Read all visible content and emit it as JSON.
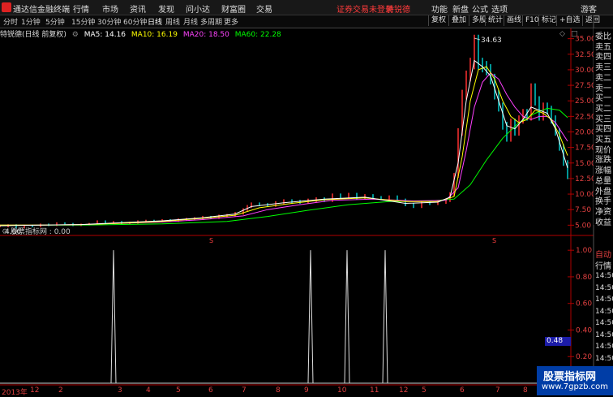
{
  "app": {
    "name": "通达信金融终端",
    "menu": [
      "行情",
      "市场",
      "资讯",
      "发现",
      "问小达",
      "财富圈",
      "交易"
    ],
    "notice": "证券交易未登录",
    "notice_stock": "特锐德",
    "right_menu": [
      "功能",
      "新盘",
      "公式",
      "选项",
      "游客"
    ]
  },
  "toolbar": {
    "periods": [
      "分时",
      "1分钟",
      "5分钟",
      "15分钟",
      "30分钟",
      "60分钟",
      "日线",
      "周线",
      "月线",
      "多周期",
      "更多"
    ],
    "active_period": "日线",
    "buttons": [
      "复权",
      "叠加",
      "多股",
      "统计",
      "画线",
      "F10",
      "标记",
      "+自选",
      "返回"
    ]
  },
  "legend": {
    "title": "特锐德(日线 前复权)",
    "ma5": "MA5: 14.16",
    "ma10": "MA10: 16.19",
    "ma20": "MA20: 18.50",
    "ma60": "MA60: 22.28"
  },
  "colors": {
    "ma5": "#ffffff",
    "ma10": "#ffff00",
    "ma20": "#ff40ff",
    "ma60": "#00ff00",
    "axis": "#e04040",
    "up": "#ff3030",
    "down": "#00c8c8"
  },
  "price_axis": [
    "35.00",
    "32.50",
    "30.00",
    "27.50",
    "25.00",
    "22.50",
    "20.00",
    "17.50",
    "15.00",
    "12.50",
    "10.00",
    "7.50",
    "5.00"
  ],
  "price_labels": {
    "high": "34.63",
    "low": "4.06"
  },
  "side_panel": [
    "委比",
    "卖五",
    "卖四",
    "卖三",
    "卖二",
    "卖一",
    "买一",
    "买二",
    "买三",
    "买四",
    "买五",
    "现价",
    "涨跌",
    "涨幅",
    "总量",
    "外盘",
    "换手",
    "净资",
    "收益"
  ],
  "auto_panel": {
    "label1": "自动",
    "label2": "行情",
    "times": [
      "14:50",
      "14:50",
      "14:50",
      "14:50",
      "14:50",
      "14:50",
      "14:50",
      "14:50",
      "14:50"
    ]
  },
  "indicator": {
    "title": "股票指标网 : 0.00",
    "axis": [
      "1.00",
      "0.80",
      "0.60",
      "0.40",
      "0.20"
    ],
    "highlight": "0.48"
  },
  "x_axis": [
    "2013年",
    "12",
    "2",
    "3",
    "4",
    "5",
    "6",
    "7",
    "8",
    "9",
    "10",
    "11",
    "12",
    "5",
    "6",
    "7",
    "8"
  ],
  "watermark": {
    "line1": "股票指标网",
    "line2": "www.7gpzb.com"
  },
  "chart_data": {
    "type": "line",
    "price_series": [
      [
        0,
        4.8
      ],
      [
        10,
        5.0
      ],
      [
        20,
        4.6
      ],
      [
        30,
        4.9
      ],
      [
        40,
        4.8
      ],
      [
        50,
        5.1
      ],
      [
        60,
        5.0
      ],
      [
        70,
        5.3
      ],
      [
        80,
        5.2
      ],
      [
        90,
        5.0
      ],
      [
        100,
        5.1
      ],
      [
        110,
        5.2
      ],
      [
        120,
        5.6
      ],
      [
        130,
        5.4
      ],
      [
        140,
        5.5
      ],
      [
        150,
        5.3
      ],
      [
        160,
        5.4
      ],
      [
        170,
        5.6
      ],
      [
        180,
        5.7
      ],
      [
        190,
        5.6
      ],
      [
        200,
        5.8
      ],
      [
        210,
        5.7
      ],
      [
        220,
        5.9
      ],
      [
        230,
        6.0
      ],
      [
        240,
        6.1
      ],
      [
        250,
        6.3
      ],
      [
        260,
        6.2
      ],
      [
        270,
        6.5
      ],
      [
        280,
        6.6
      ],
      [
        290,
        6.9
      ],
      [
        300,
        7.5
      ],
      [
        305,
        8.0
      ],
      [
        310,
        8.4
      ],
      [
        320,
        8.3
      ],
      [
        330,
        8.2
      ],
      [
        340,
        8.6
      ],
      [
        350,
        8.9
      ],
      [
        360,
        8.8
      ],
      [
        370,
        8.7
      ],
      [
        380,
        9.0
      ],
      [
        390,
        9.2
      ],
      [
        400,
        9.0
      ],
      [
        410,
        9.8
      ],
      [
        420,
        9.6
      ],
      [
        430,
        9.9
      ],
      [
        440,
        9.4
      ],
      [
        450,
        9.7
      ],
      [
        460,
        9.4
      ],
      [
        470,
        9.3
      ],
      [
        480,
        9.5
      ],
      [
        490,
        9.0
      ],
      [
        500,
        8.3
      ],
      [
        510,
        8.0
      ],
      [
        520,
        8.6
      ],
      [
        530,
        8.5
      ],
      [
        540,
        8.7
      ],
      [
        550,
        9.0
      ],
      [
        555,
        10.0
      ],
      [
        560,
        13.0
      ],
      [
        565,
        20.0
      ],
      [
        570,
        26.0
      ],
      [
        575,
        29.0
      ],
      [
        580,
        31.0
      ],
      [
        585,
        34.6
      ],
      [
        590,
        31.0
      ],
      [
        595,
        30.5
      ],
      [
        600,
        30.0
      ],
      [
        605,
        28.5
      ],
      [
        610,
        26.0
      ],
      [
        615,
        24.0
      ],
      [
        620,
        21.0
      ],
      [
        625,
        19.0
      ],
      [
        630,
        21.5
      ],
      [
        635,
        20.0
      ],
      [
        640,
        22.0
      ],
      [
        645,
        23.0
      ],
      [
        650,
        22.5
      ],
      [
        655,
        27.0
      ],
      [
        660,
        25.0
      ],
      [
        665,
        22.5
      ],
      [
        670,
        24.0
      ],
      [
        675,
        23.5
      ],
      [
        680,
        22.0
      ],
      [
        685,
        20.0
      ],
      [
        690,
        17.5
      ],
      [
        695,
        15.0
      ],
      [
        700,
        12.8
      ]
    ],
    "ma5": [
      [
        0,
        4.9
      ],
      [
        50,
        5.0
      ],
      [
        100,
        5.1
      ],
      [
        150,
        5.4
      ],
      [
        200,
        5.7
      ],
      [
        250,
        6.2
      ],
      [
        290,
        6.8
      ],
      [
        310,
        8.0
      ],
      [
        350,
        8.6
      ],
      [
        400,
        9.2
      ],
      [
        450,
        9.5
      ],
      [
        500,
        8.5
      ],
      [
        540,
        8.7
      ],
      [
        555,
        9.5
      ],
      [
        565,
        15.0
      ],
      [
        575,
        25.0
      ],
      [
        585,
        31.5
      ],
      [
        595,
        30.5
      ],
      [
        605,
        29.0
      ],
      [
        615,
        25.0
      ],
      [
        625,
        21.0
      ],
      [
        635,
        20.5
      ],
      [
        645,
        22.0
      ],
      [
        655,
        24.0
      ],
      [
        665,
        23.5
      ],
      [
        675,
        23.0
      ],
      [
        685,
        20.5
      ],
      [
        700,
        14.2
      ]
    ],
    "ma10": [
      [
        0,
        5.0
      ],
      [
        50,
        5.0
      ],
      [
        100,
        5.1
      ],
      [
        150,
        5.3
      ],
      [
        200,
        5.6
      ],
      [
        250,
        6.1
      ],
      [
        290,
        6.6
      ],
      [
        320,
        7.8
      ],
      [
        360,
        8.5
      ],
      [
        400,
        9.1
      ],
      [
        450,
        9.4
      ],
      [
        500,
        8.8
      ],
      [
        540,
        8.8
      ],
      [
        560,
        9.6
      ],
      [
        570,
        16.0
      ],
      [
        580,
        25.0
      ],
      [
        590,
        30.0
      ],
      [
        600,
        30.5
      ],
      [
        610,
        28.5
      ],
      [
        620,
        25.0
      ],
      [
        630,
        22.5
      ],
      [
        640,
        21.5
      ],
      [
        650,
        22.0
      ],
      [
        660,
        23.5
      ],
      [
        670,
        23.0
      ],
      [
        680,
        22.0
      ],
      [
        690,
        19.5
      ],
      [
        700,
        16.2
      ]
    ],
    "ma20": [
      [
        0,
        5.0
      ],
      [
        50,
        5.0
      ],
      [
        100,
        5.1
      ],
      [
        150,
        5.3
      ],
      [
        200,
        5.5
      ],
      [
        250,
        5.9
      ],
      [
        300,
        6.5
      ],
      [
        330,
        7.5
      ],
      [
        370,
        8.3
      ],
      [
        410,
        9.0
      ],
      [
        460,
        9.2
      ],
      [
        510,
        8.9
      ],
      [
        550,
        9.0
      ],
      [
        565,
        11.0
      ],
      [
        575,
        17.0
      ],
      [
        585,
        24.0
      ],
      [
        595,
        28.0
      ],
      [
        605,
        29.5
      ],
      [
        615,
        28.5
      ],
      [
        625,
        26.0
      ],
      [
        635,
        24.0
      ],
      [
        645,
        22.5
      ],
      [
        655,
        22.0
      ],
      [
        665,
        22.5
      ],
      [
        675,
        22.5
      ],
      [
        685,
        21.5
      ],
      [
        700,
        18.5
      ]
    ],
    "ma60": [
      [
        0,
        5.0
      ],
      [
        100,
        5.0
      ],
      [
        200,
        5.2
      ],
      [
        280,
        5.6
      ],
      [
        330,
        6.4
      ],
      [
        380,
        7.4
      ],
      [
        430,
        8.3
      ],
      [
        480,
        8.8
      ],
      [
        530,
        8.9
      ],
      [
        560,
        9.2
      ],
      [
        580,
        11.5
      ],
      [
        600,
        15.5
      ],
      [
        620,
        19.0
      ],
      [
        640,
        21.5
      ],
      [
        660,
        23.0
      ],
      [
        675,
        23.8
      ],
      [
        690,
        23.5
      ],
      [
        700,
        22.3
      ]
    ],
    "y_range": [
      4.0,
      36.0
    ],
    "signal_spikes": [
      140,
      383,
      428,
      475
    ],
    "signal_value": 1.0,
    "signal_ylim": [
      0,
      1.05
    ]
  }
}
